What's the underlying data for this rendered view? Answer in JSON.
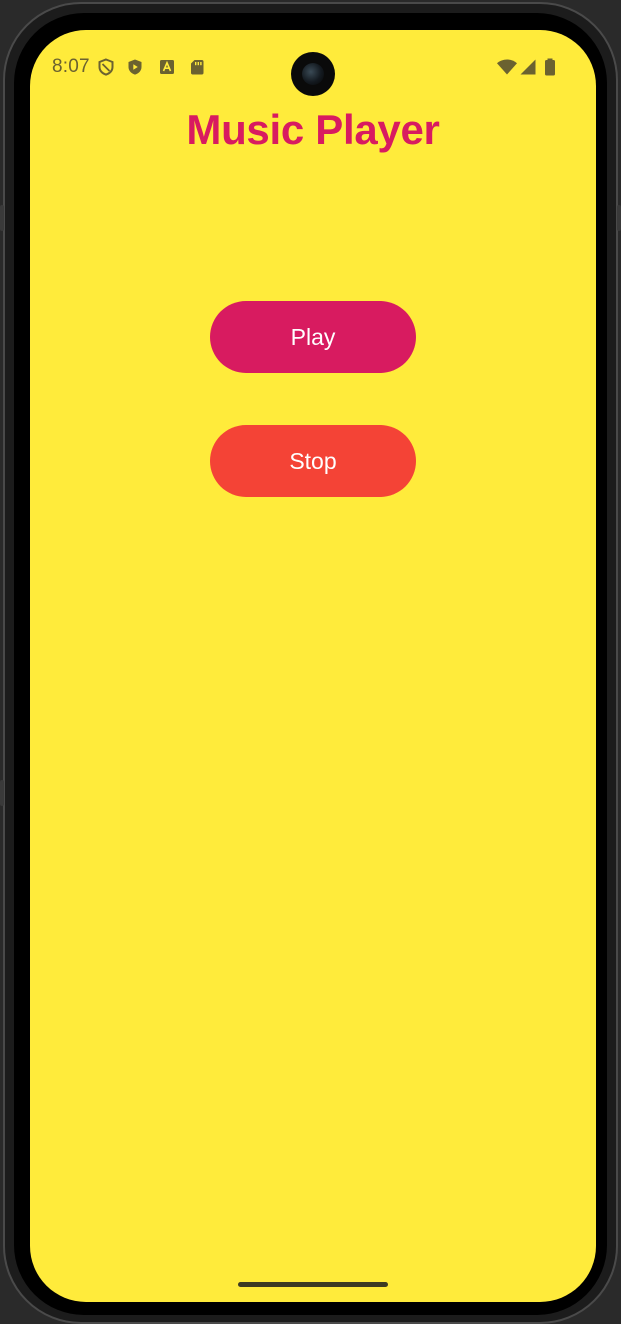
{
  "status_bar": {
    "time": "8:07",
    "left_icons": [
      "shield-outline-icon",
      "play-protect-icon",
      "font-a-icon",
      "sd-card-icon"
    ],
    "right_icons": [
      "wifi-icon",
      "cellular-signal-icon",
      "battery-icon"
    ]
  },
  "app": {
    "title": "Music Player",
    "play_label": "Play",
    "stop_label": "Stop"
  },
  "colors": {
    "background": "#ffeb3b",
    "title": "#d81b60",
    "play_button": "#d81b60",
    "stop_button": "#f44336",
    "button_text": "#ffffff"
  }
}
